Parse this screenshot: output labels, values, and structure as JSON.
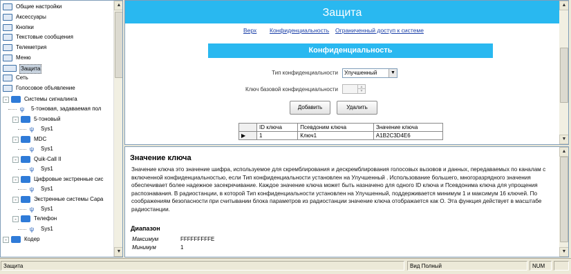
{
  "tree": {
    "items": [
      {
        "label": "Общие настройки",
        "kind": "box"
      },
      {
        "label": "Аксессуары",
        "kind": "box"
      },
      {
        "label": "Кнопки",
        "kind": "box"
      },
      {
        "label": "Текстовые сообщения",
        "kind": "box"
      },
      {
        "label": "Телеметрия",
        "kind": "box"
      },
      {
        "label": "Меню",
        "kind": "box"
      },
      {
        "label": "Защита",
        "kind": "box",
        "selected": true
      },
      {
        "label": "Сеть",
        "kind": "box"
      },
      {
        "label": "Голосовое объявление",
        "kind": "box"
      },
      {
        "label": "Системы сигналинга",
        "kind": "folder"
      },
      {
        "label": "5-тоновая, задаваемая пол",
        "kind": "antenna"
      },
      {
        "label": "5-тоновый",
        "kind": "folder"
      },
      {
        "label": "Sys1",
        "kind": "antenna"
      },
      {
        "label": "MDC",
        "kind": "folder"
      },
      {
        "label": "Sys1",
        "kind": "antenna"
      },
      {
        "label": "Quik-Call II",
        "kind": "folder"
      },
      {
        "label": "Sys1",
        "kind": "antenna"
      },
      {
        "label": "Цифровые экстренные сис",
        "kind": "folder"
      },
      {
        "label": "Sys1",
        "kind": "antenna"
      },
      {
        "label": "Экстренные системы Сара",
        "kind": "folder"
      },
      {
        "label": "Sys1",
        "kind": "antenna"
      },
      {
        "label": "Телефон",
        "kind": "folder"
      },
      {
        "label": "Sys1",
        "kind": "antenna"
      },
      {
        "label": "Кодер",
        "kind": "folder"
      }
    ]
  },
  "upper": {
    "title": "Защита",
    "links": [
      "Верх",
      "Конфиденциальность",
      "Ограниченный доступ к системе"
    ],
    "section_title": "Конфиденциальность",
    "privacy_type_label": "Тип конфиденциальности",
    "privacy_type_value": "Улучшенный",
    "basic_key_label": "Ключ базовой конфиденциальности",
    "add_button": "Добавить",
    "delete_button": "Удалить",
    "table": {
      "columns": [
        "ID ключа",
        "Псевдоним ключа",
        "Значение ключа"
      ],
      "rows": [
        [
          "1",
          "Ключ1",
          "A1B2C3D4E6"
        ]
      ]
    }
  },
  "help": {
    "title": "Значение ключа",
    "body": "Значение ключа это значение шифра, используемое для скремблирования и дескремблирования голосовых вызовов и данных, передаваемых по каналам с включенной конфиденциальностью, если Тип конфиденциальности установлен на Улучшенный . Использование большего, многоразрядного значения обеспечивает более надежное засекречивание. Каждое значение ключа может быть назначено для одного ID ключа и Псевдонима ключа для упрощения распознавания. В радиостанции, в которой Тип конфиденциальности установлен на Улучшенный, поддерживается минимум 1 и максимум 16 ключей. По соображениям безопасности при считывании блока параметров из радиостанции значение ключа отображается как О. Эта функция действует в масштабе радиостанции.",
    "range_title": "Диапазон",
    "max_label": "Максимум",
    "max_value": "FFFFFFFFFE",
    "min_label": "Минимум",
    "min_value": "1"
  },
  "status": {
    "left": "Защита",
    "view": "Вид Полный",
    "num": "NUM"
  },
  "colors": {
    "accent": "#29b8f0",
    "link": "#1a3fa8"
  }
}
